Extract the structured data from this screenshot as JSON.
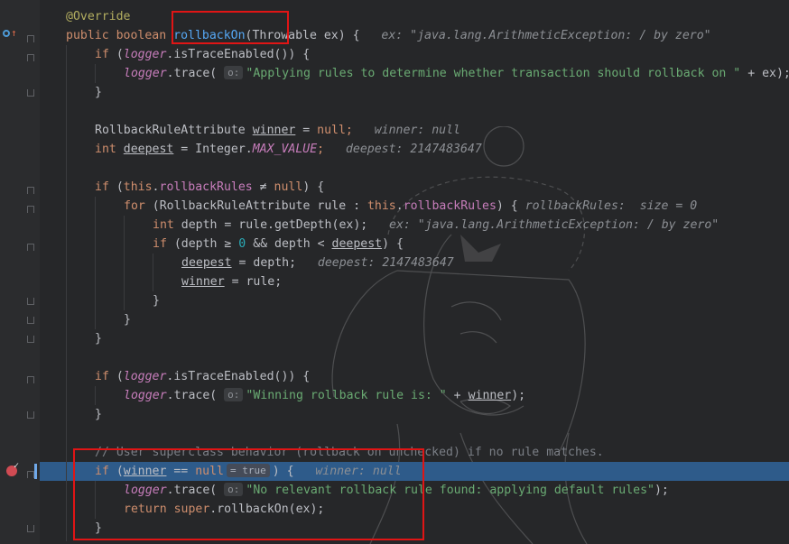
{
  "editor": {
    "lines": {
      "l1": {
        "annotation": "@Override"
      },
      "l2": {
        "kw_public": "public",
        "kw_boolean": "boolean",
        "method": "rollbackOn",
        "sig_rest": "(Throwable ex) {",
        "hint": "ex: \"java.lang.ArithmeticException: / by zero\""
      },
      "l3": {
        "kw_if": "if",
        "paren_open": " (",
        "logger": "logger",
        "call": ".isTraceEnabled()) {"
      },
      "l4": {
        "logger": "logger",
        "call": ".trace(",
        "param_hint": "o:",
        "str": "\"Applying rules to determine whether transaction should rollback on \"",
        "tail": " + ex);"
      },
      "l5": {
        "brace": "}"
      },
      "l6": {},
      "l7": {
        "type": "RollbackRuleAttribute",
        "var": "winner",
        "eq": " = ",
        "kw_null": "null",
        "semi": ";",
        "hint": "winner: null"
      },
      "l8": {
        "kw_int": "int",
        "var": "deepest",
        "eq": " = Integer.",
        "const": "MAX_VALUE",
        "semi": ";",
        "hint": "deepest: 2147483647"
      },
      "l9": {},
      "l10": {
        "kw_if": "if",
        "paren_open": " (",
        "kw_this": "this",
        "dot": ".",
        "field": "rollbackRules",
        "op": " ≠ ",
        "kw_null": "null",
        "close": ") {"
      },
      "l11": {
        "kw_for": "for",
        "open": " (RollbackRuleAttribute rule : ",
        "kw_this": "this",
        "dot": ".",
        "field": "rollbackRules",
        "close": ") {",
        "hint": "rollbackRules:  size = 0"
      },
      "l12": {
        "kw_int": "int",
        "code": " depth = rule.getDepth(ex);",
        "hint": "ex: \"java.lang.ArithmeticException: / by zero\""
      },
      "l13": {
        "kw_if": "if",
        "open": " (depth ≥ ",
        "num": "0",
        "mid": " && depth < ",
        "var": "deepest",
        "close": ") {"
      },
      "l14": {
        "var": "deepest",
        "code": " = depth;",
        "hint": "deepest: 2147483647"
      },
      "l15": {
        "var": "winner",
        "code": " = rule;"
      },
      "l16": {
        "brace": "}"
      },
      "l17": {
        "brace": "}"
      },
      "l18": {
        "brace": "}"
      },
      "l19": {},
      "l20": {
        "kw_if": "if",
        "paren_open": " (",
        "logger": "logger",
        "call": ".isTraceEnabled()) {"
      },
      "l21": {
        "logger": "logger",
        "call": ".trace(",
        "param_hint": "o:",
        "str": "\"Winning rollback rule is: \"",
        "mid": " + ",
        "var": "winner",
        "tail": ");"
      },
      "l22": {
        "brace": "}"
      },
      "l23": {},
      "l24": {
        "comment": "// User superclass behavior (rollback on unchecked) if no rule matches."
      },
      "l25": {
        "kw_if": "if",
        "paren_open": " (",
        "var": "winner",
        "op": " == ",
        "kw_null": "null",
        "badge": "= true",
        "close": ") {",
        "hint": "winner: null"
      },
      "l26": {
        "logger": "logger",
        "call": ".trace(",
        "param_hint": "o:",
        "str": "\"No relevant rollback rule found: applying default rules\"",
        "tail": ");"
      },
      "l27": {
        "kw_return": "return",
        "kw_super": "super",
        "call": ".rollbackOn(ex);"
      },
      "l28": {
        "brace": "}"
      }
    }
  },
  "colors": {
    "background": "#262729",
    "current_line": "#2e5b8a",
    "highlight_box": "#e01515",
    "keyword": "#cf8e6d",
    "string": "#6aab73",
    "method": "#56a8f5",
    "field": "#c77dbb"
  },
  "icons": {
    "gutter_line2": "override-method-icon",
    "gutter_line25": "breakpoint-icon"
  }
}
